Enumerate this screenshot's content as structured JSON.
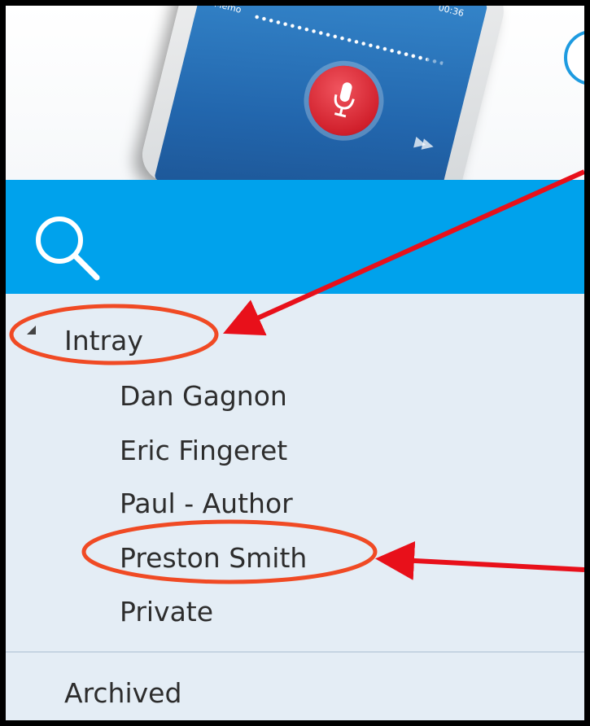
{
  "phone": {
    "time": "00:36",
    "memo_label": "Memo",
    "info_glyph": "!"
  },
  "search": {
    "icon": "search-icon"
  },
  "tree": {
    "intray": {
      "label": "Intray",
      "expanded": true,
      "children": [
        {
          "label": "Dan Gagnon"
        },
        {
          "label": "Eric Fingeret"
        },
        {
          "label": "Paul - Author"
        },
        {
          "label": "Preston Smith"
        },
        {
          "label": "Private"
        }
      ]
    },
    "archived": {
      "label": "Archived"
    }
  },
  "colors": {
    "search_bar": "#00a2ec",
    "tree_background": "#e4edf5",
    "annotation": "#f04a24",
    "arrow": "#e8101a"
  }
}
